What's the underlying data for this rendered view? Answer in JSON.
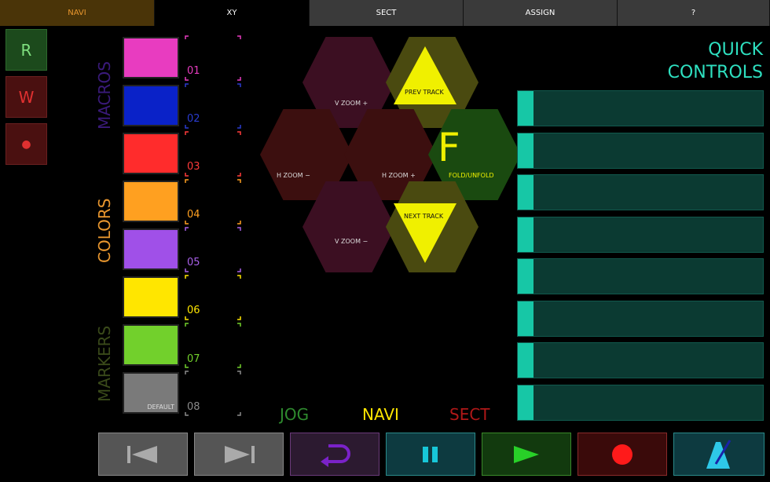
{
  "tabs": [
    {
      "label": "NAVI",
      "color": "#e8962e",
      "bg": "#4a3408"
    },
    {
      "label": "XY",
      "color": "#ffffff",
      "bg": "#000000"
    },
    {
      "label": "SECT",
      "color": "#ffffff",
      "bg": "#3a3a3a"
    },
    {
      "label": "ASSIGN",
      "color": "#ffffff",
      "bg": "#3a3a3a"
    },
    {
      "label": "?",
      "color": "#ffffff",
      "bg": "#3a3a3a"
    }
  ],
  "side_buttons": [
    {
      "label": "R",
      "color": "#7fe07f"
    },
    {
      "label": "W",
      "color": "#e03030"
    },
    {
      "label": "●",
      "color": "#e03030"
    }
  ],
  "section_labels": {
    "macros": "MACROS",
    "colors": "COLORS",
    "markers": "MARKERS"
  },
  "swatches": [
    {
      "num": "01",
      "color": "#e83cc0",
      "numColor": "#e83cc0"
    },
    {
      "num": "02",
      "color": "#0a22c8",
      "numColor": "#2a3cd0"
    },
    {
      "num": "03",
      "color": "#ff2c2c",
      "numColor": "#ff3a3a"
    },
    {
      "num": "04",
      "color": "#ffa020",
      "numColor": "#ffa020"
    },
    {
      "num": "05",
      "color": "#a050e8",
      "numColor": "#a860e8"
    },
    {
      "num": "06",
      "color": "#ffe600",
      "numColor": "#ffe600"
    },
    {
      "num": "07",
      "color": "#72d02c",
      "numColor": "#72d02c"
    },
    {
      "num": "08",
      "color": "#7a7a7a",
      "numColor": "#8a8a8a",
      "sub": "DEFAULT"
    }
  ],
  "hexes": {
    "vzoom_plus": "V ZOOM +",
    "prev_track": "PREV TRACK",
    "hzoom_minus": "H ZOOM −",
    "hzoom_plus": "H ZOOM +",
    "fold_letter": "F",
    "fold": "FOLD/UNFOLD",
    "vzoom_minus": "V ZOOM −",
    "next_track": "NEXT TRACK"
  },
  "modes": {
    "jog": "JOG",
    "navi": "NAVI",
    "sect": "SECT"
  },
  "quick_controls": {
    "line1": "QUICK",
    "line2": "CONTROLS",
    "count": 8
  },
  "transport": [
    {
      "name": "prev-marker",
      "icon": "skip-back-icon"
    },
    {
      "name": "next-marker",
      "icon": "skip-forward-icon"
    },
    {
      "name": "loop",
      "icon": "loop-icon"
    },
    {
      "name": "pause",
      "icon": "pause-icon"
    },
    {
      "name": "play",
      "icon": "play-icon"
    },
    {
      "name": "record",
      "icon": "record-icon"
    },
    {
      "name": "metronome",
      "icon": "metronome-icon"
    }
  ]
}
